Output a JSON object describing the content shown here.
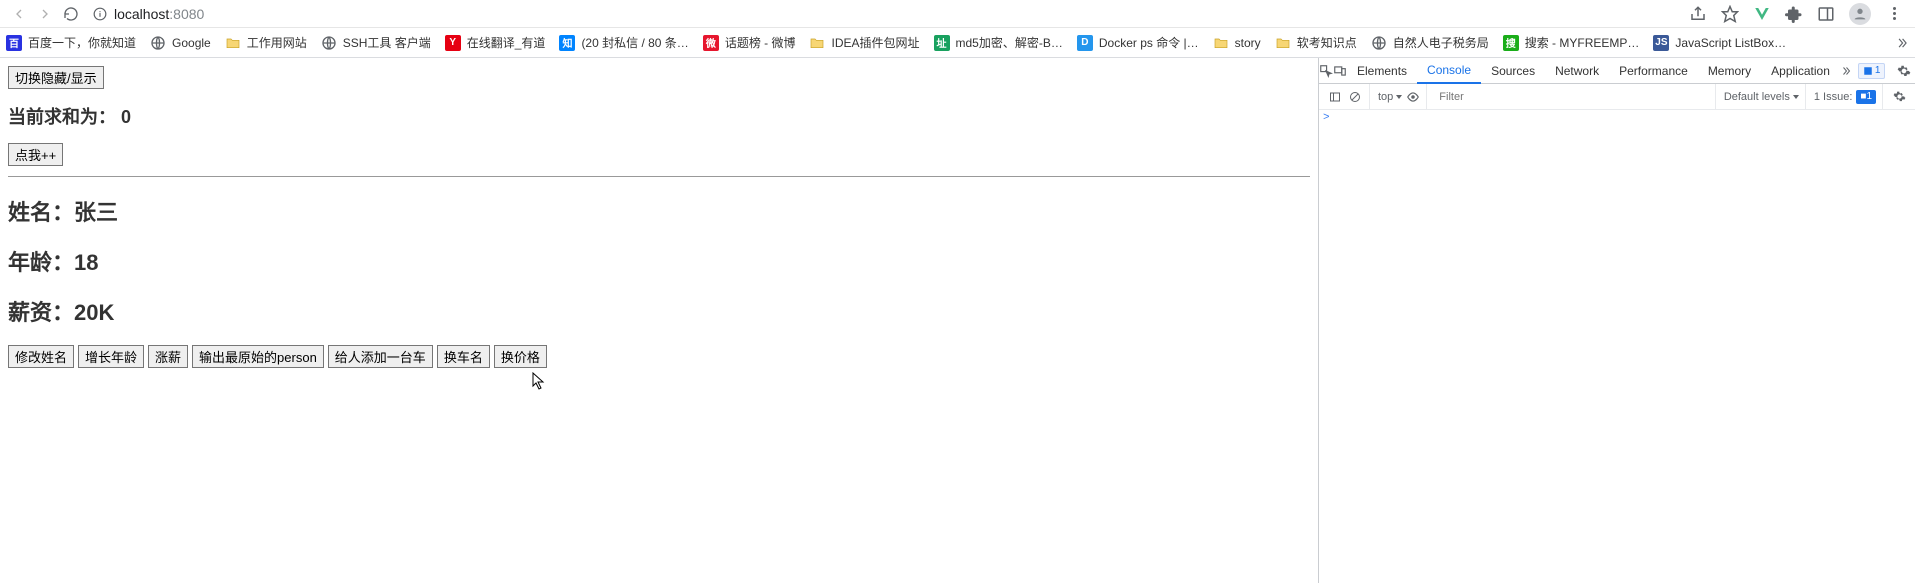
{
  "browser": {
    "url_host": "localhost",
    "url_port": ":8080"
  },
  "toolbar_icons": {
    "share": "share-icon",
    "star": "star-icon",
    "vue": "vue-icon",
    "ext": "extensions-icon",
    "panel": "panel-icon",
    "avatar": "avatar-icon",
    "menu": "menu-icon"
  },
  "bookmarks": [
    {
      "label": "百度一下，你就知道",
      "color": "#2932e1",
      "glyph": "百"
    },
    {
      "label": "Google",
      "color": "#ffffff",
      "glyph": "G",
      "globe": true
    },
    {
      "label": "工作用网站",
      "color": "#f7d674",
      "glyph": "",
      "folder": true
    },
    {
      "label": "SSH工具 客户端",
      "color": "#ffffff",
      "glyph": "",
      "globe": true
    },
    {
      "label": "在线翻译_有道",
      "color": "#e60012",
      "glyph": "Y"
    },
    {
      "label": "(20 封私信 / 80 条…",
      "color": "#0084ff",
      "glyph": "知"
    },
    {
      "label": "话题榜 - 微博",
      "color": "#e6162d",
      "glyph": "微"
    },
    {
      "label": "IDEA插件包网址",
      "color": "#f7d674",
      "glyph": "",
      "folder": true
    },
    {
      "label": "md5加密、解密-B…",
      "color": "#19a15f",
      "glyph": "址"
    },
    {
      "label": "Docker ps 命令 |…",
      "color": "#2496ed",
      "glyph": "D"
    },
    {
      "label": "story",
      "color": "#f7d674",
      "glyph": "",
      "folder": true
    },
    {
      "label": "软考知识点",
      "color": "#f7d674",
      "glyph": "",
      "folder": true
    },
    {
      "label": "自然人电子税务局",
      "color": "#ffffff",
      "glyph": "",
      "globe": true
    },
    {
      "label": "搜索 - MYFREEMP…",
      "color": "#1aad19",
      "glyph": "搜"
    },
    {
      "label": "JavaScript ListBox…",
      "color": "#3b5998",
      "glyph": "JS"
    }
  ],
  "page": {
    "toggle_btn": "切换隐藏/显示",
    "sum_label": "当前求和为：",
    "sum_value": "0",
    "incr_btn": "点我++",
    "name_label": "姓名：",
    "name_value": "张三",
    "age_label": "年龄：",
    "age_value": "18",
    "salary_label": "薪资：",
    "salary_value": "20K",
    "buttons": [
      "修改姓名",
      "增长年龄",
      "涨薪",
      "输出最原始的person",
      "给人添加一台车",
      "换车名",
      "换价格"
    ]
  },
  "devtools": {
    "tabs": [
      "Elements",
      "Console",
      "Sources",
      "Network",
      "Performance",
      "Memory",
      "Application"
    ],
    "active_tab": "Console",
    "badge_count": "1",
    "filter_top": "top",
    "filter_placeholder": "Filter",
    "levels": "Default levels",
    "issues_label": "1 Issue:",
    "issues_count": "1",
    "prompt": ">"
  }
}
